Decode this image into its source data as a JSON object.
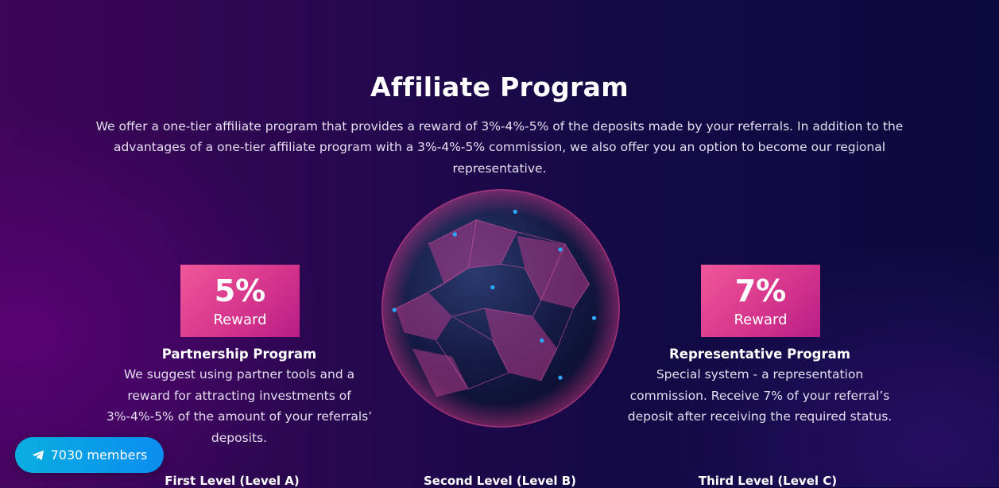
{
  "section": {
    "title": "Affiliate Program",
    "intro": "We offer a one-tier affiliate program that provides a reward of 3%-4%-5% of the deposits made by your referrals. In addition to the advantages of a one-tier affiliate program with a 3%-4%-5% commission, we also offer you an option to become our regional representative."
  },
  "programs": [
    {
      "percent": "5%",
      "reward_label": "Reward",
      "title": "Partnership Program",
      "description": "We suggest using partner tools and a reward for attracting investments of 3%-4%-5% of the amount of your referrals’ deposits."
    },
    {
      "percent": "7%",
      "reward_label": "Reward",
      "title": "Representative Program",
      "description": "Special system - a representation commission. Receive 7% of your referral’s deposit after receiving the required status."
    }
  ],
  "levels": [
    "First Level (Level A)",
    "Second Level (Level B)",
    "Third Level (Level C)"
  ],
  "telegram": {
    "label": "7030 members",
    "icon": "telegram-icon"
  },
  "colors": {
    "accent_pink": "#e2468f",
    "button_blue": "#0a9ee8",
    "background_dark": "#140a46"
  }
}
